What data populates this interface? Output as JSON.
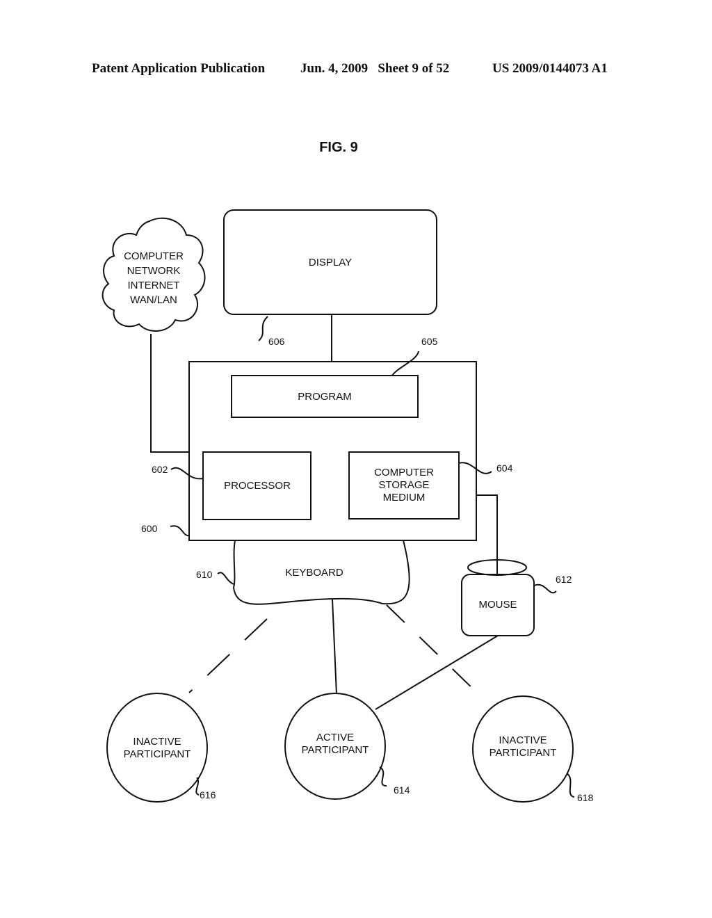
{
  "header": {
    "left": "Patent Application Publication",
    "middle": "Jun. 4, 2009   Sheet 9 of 52",
    "right": "US 2009/0144073 A1"
  },
  "figure": {
    "title": "FIG. 9",
    "nodes": {
      "network": [
        "COMPUTER",
        "NETWORK",
        "INTERNET",
        "WAN/LAN"
      ],
      "display": "DISPLAY",
      "program": "PROGRAM",
      "processor": "PROCESSOR",
      "storage": [
        "COMPUTER",
        "STORAGE",
        "MEDIUM"
      ],
      "keyboard": "KEYBOARD",
      "mouse": "MOUSE",
      "participant_left": [
        "INACTIVE",
        "PARTICIPANT"
      ],
      "participant_center": [
        "ACTIVE",
        "PARTICIPANT"
      ],
      "participant_right": [
        "INACTIVE",
        "PARTICIPANT"
      ]
    },
    "refs": {
      "computer": "600",
      "processor": "602",
      "storage": "604",
      "program": "605",
      "display": "606",
      "keyboard": "610",
      "mouse": "612",
      "active": "614",
      "inactive_left": "616",
      "inactive_right": "618"
    }
  }
}
